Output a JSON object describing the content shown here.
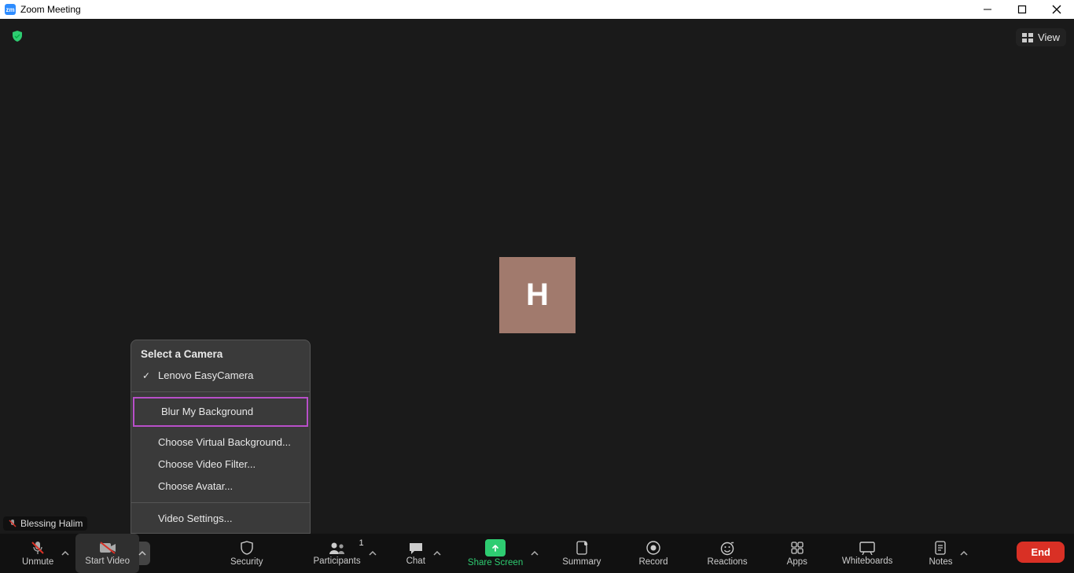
{
  "window": {
    "title": "Zoom Meeting"
  },
  "top": {
    "view_label": "View"
  },
  "avatar": {
    "initial": "H"
  },
  "name_tag": {
    "participant_name": "Blessing Halim"
  },
  "video_menu": {
    "header": "Select a Camera",
    "camera": "Lenovo EasyCamera",
    "blur": "Blur My Background",
    "virtual_bg": "Choose Virtual Background...",
    "filter": "Choose Video Filter...",
    "avatar_opt": "Choose Avatar...",
    "settings": "Video Settings..."
  },
  "toolbar": {
    "unmute": "Unmute",
    "start_video": "Start Video",
    "security": "Security",
    "participants": "Participants",
    "participants_count": "1",
    "chat": "Chat",
    "share_screen": "Share Screen",
    "summary": "Summary",
    "record": "Record",
    "reactions": "Reactions",
    "apps": "Apps",
    "whiteboards": "Whiteboards",
    "notes": "Notes",
    "end": "End"
  }
}
